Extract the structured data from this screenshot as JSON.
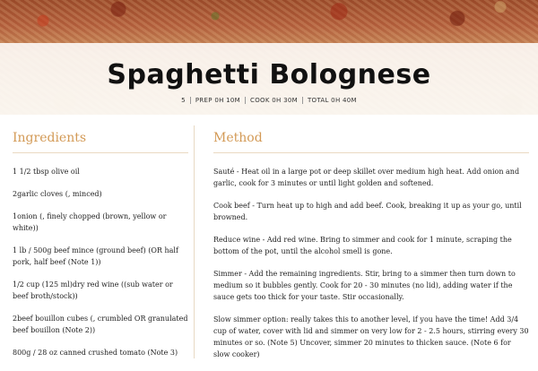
{
  "recipe": {
    "title": "Spaghetti Bolognese",
    "meta": {
      "servings": "5",
      "prep": "PREP 0H 10M",
      "cook": "COOK 0H 30M",
      "total": "TOTAL 0H 40M"
    }
  },
  "ingredients": {
    "heading": "Ingredients",
    "items": [
      "1 1/2 tbsp olive oil",
      "2garlic cloves (, minced)",
      "1onion (, finely chopped (brown, yellow or white))",
      "1 lb / 500g beef mince (ground beef) (OR half pork, half beef (Note 1))",
      "1/2 cup (125 ml)dry red wine ((sub water or beef broth/stock))",
      "2beef bouillon cubes (, crumbled OR granulated beef bouillon (Note 2))",
      "800g / 28 oz canned crushed tomato (Note 3)"
    ]
  },
  "method": {
    "heading": "Method",
    "steps": [
      "Sauté - Heat oil in a large pot or deep skillet over medium high heat. Add onion and garlic, cook for 3 minutes or until light golden and softened.",
      "Cook beef - Turn heat up to high and add beef. Cook, breaking it up as your go, until browned.",
      "Reduce wine - Add red wine. Bring to simmer and cook for 1 minute, scraping the bottom of the pot, until the alcohol smell is gone.",
      "Simmer - Add the remaining ingredients. Stir, bring to a simmer then turn down to medium so it bubbles gently. Cook for 20 - 30 minutes (no lid), adding water if the sauce gets too thick for your taste. Stir occasionally.",
      "Slow simmer option: really takes this to another level, if you have the time! Add 3/4 cup of water, cover with lid and simmer on very low for 2 - 2.5 hours, stirring every 30 minutes or so. (Note 5) Uncover, simmer 20 minutes to thicken sauce. (Note 6 for slow cooker)"
    ]
  }
}
